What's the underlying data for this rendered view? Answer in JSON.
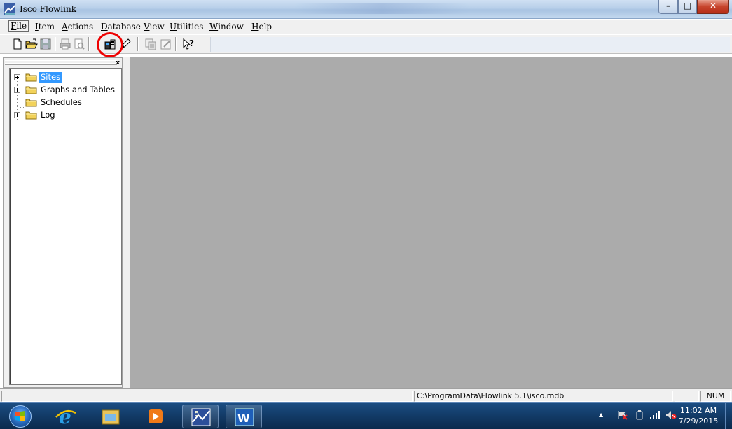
{
  "window": {
    "title": "Isco Flowlink",
    "controls": {
      "minimize": "–",
      "maximize": "□",
      "close": "✕"
    }
  },
  "menu": {
    "items": [
      {
        "label": "File",
        "accel": "F"
      },
      {
        "label": "Item",
        "accel": "I"
      },
      {
        "label": "Actions",
        "accel": "A"
      },
      {
        "label": "Database",
        "accel": "D"
      },
      {
        "label": "View",
        "accel": "V"
      },
      {
        "label": "Utilities",
        "accel": "U"
      },
      {
        "label": "Window",
        "accel": "W"
      },
      {
        "label": "Help",
        "accel": "H"
      }
    ]
  },
  "toolbar": {
    "buttons": [
      "new-icon",
      "open-icon",
      "save-icon",
      "print-icon",
      "print-preview-icon",
      "connect-site-icon",
      "pencil-icon",
      "copy-icon",
      "edit-icon",
      "context-help-icon"
    ],
    "highlighted": "connect-site-icon"
  },
  "tree": {
    "close_label": "x",
    "items": [
      {
        "label": "Sites",
        "expandable": true,
        "selected": true
      },
      {
        "label": "Graphs and Tables",
        "expandable": true,
        "selected": false
      },
      {
        "label": "Schedules",
        "expandable": false,
        "selected": false
      },
      {
        "label": "Log",
        "expandable": true,
        "selected": false
      }
    ]
  },
  "status": {
    "database_path": "C:\\ProgramData\\Flowlink 5.1\\isco.mdb",
    "extra": "",
    "num_lock": "NUM"
  },
  "taskbar": {
    "apps": [
      "internet-explorer-icon",
      "file-explorer-icon",
      "media-player-icon",
      "flowlink-icon",
      "word-icon"
    ],
    "tray_arrow": "▲",
    "time": "11:02 AM",
    "date": "7/29/2015"
  },
  "colors": {
    "mdi_background": "#ababab",
    "selection": "#3399ff",
    "highlight_circle": "#e00000",
    "taskbar": "#123a66"
  }
}
